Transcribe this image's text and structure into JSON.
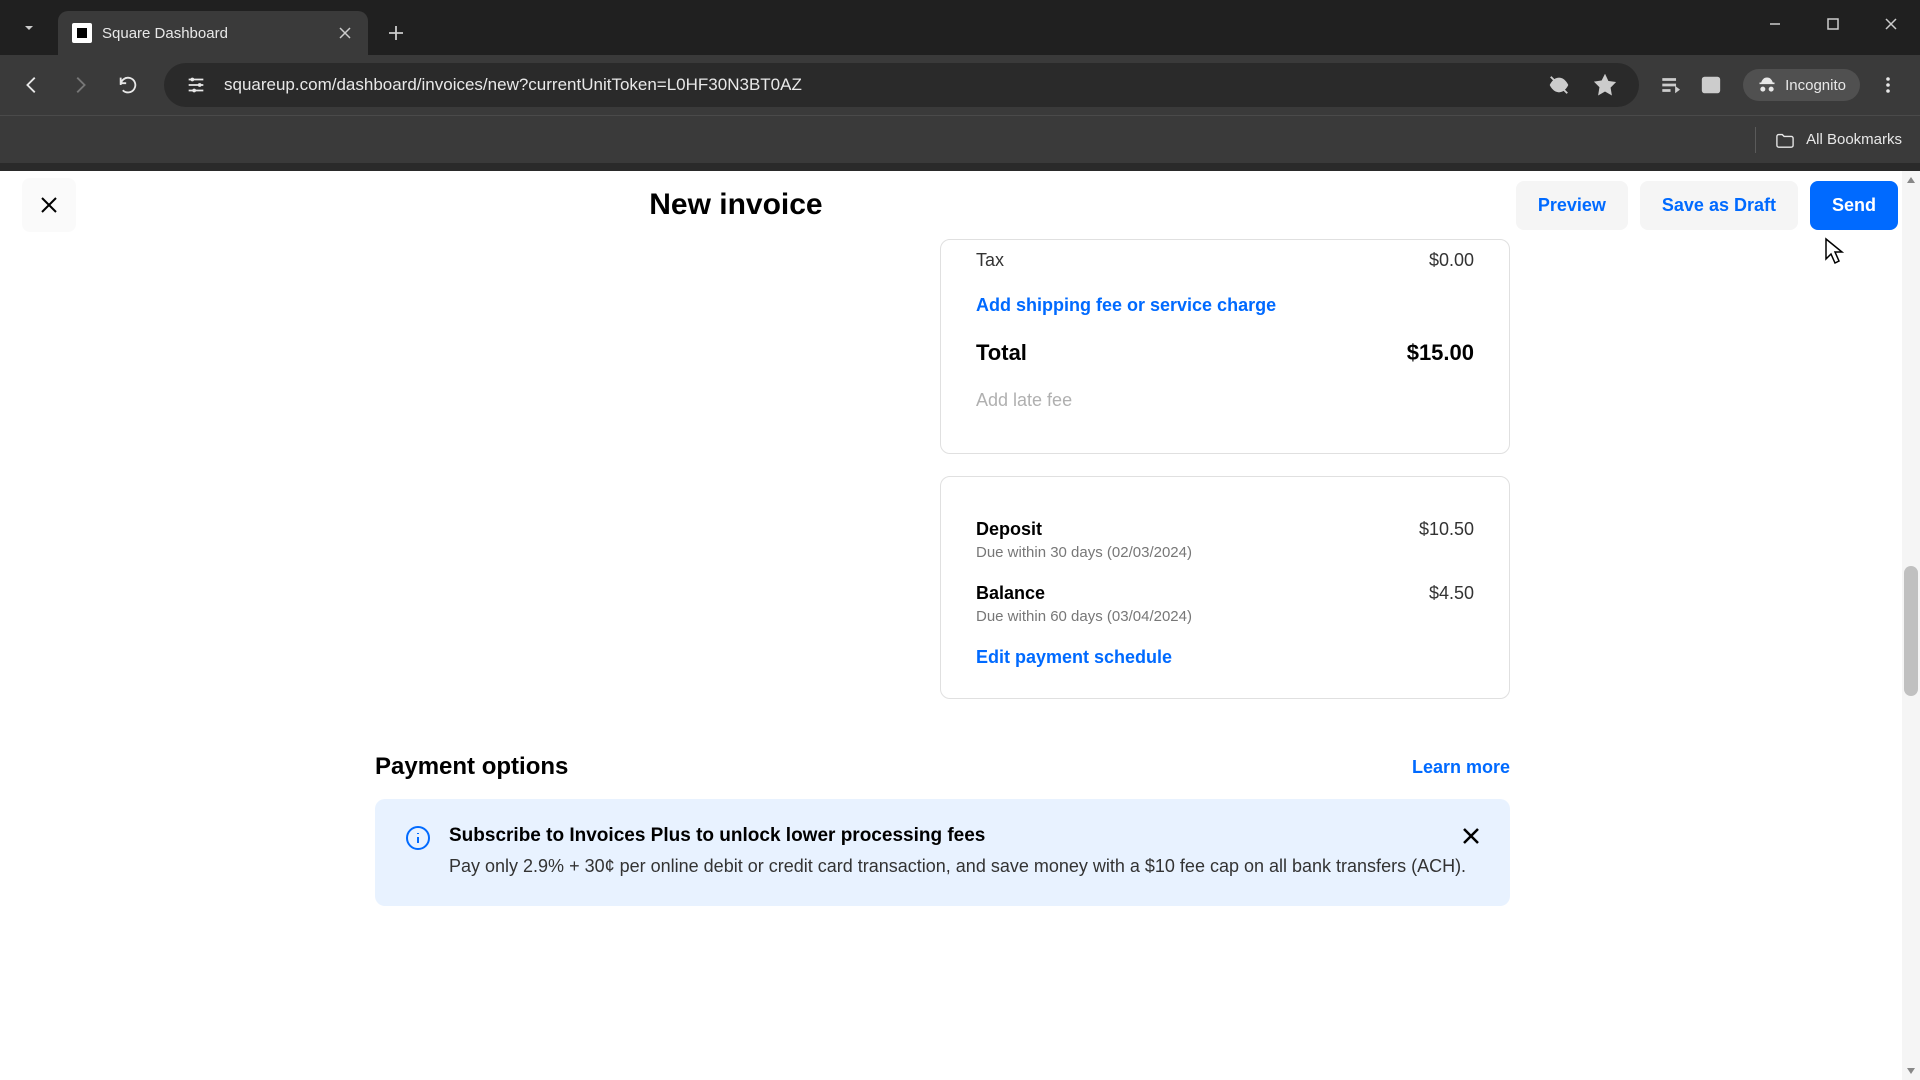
{
  "browser": {
    "tab_title": "Square Dashboard",
    "url": "squareup.com/dashboard/invoices/new?currentUnitToken=L0HF30N3BT0AZ",
    "incognito_label": "Incognito",
    "all_bookmarks_label": "All Bookmarks"
  },
  "header": {
    "title": "New invoice",
    "preview_label": "Preview",
    "save_draft_label": "Save as Draft",
    "send_label": "Send"
  },
  "summary": {
    "tax_label": "Tax",
    "tax_value": "$0.00",
    "add_shipping_label": "Add shipping fee or service charge",
    "total_label": "Total",
    "total_value": "$15.00",
    "add_late_fee_label": "Add late fee"
  },
  "schedule": {
    "deposit_label": "Deposit",
    "deposit_amount": "$10.50",
    "deposit_due": "Due within 30 days (02/03/2024)",
    "balance_label": "Balance",
    "balance_amount": "$4.50",
    "balance_due": "Due within 60 days (03/04/2024)",
    "edit_label": "Edit payment schedule"
  },
  "payment_options": {
    "title": "Payment options",
    "learn_more_label": "Learn more"
  },
  "promo": {
    "title": "Subscribe to Invoices Plus to unlock lower processing fees",
    "text": "Pay only 2.9% + 30¢ per online debit or credit card transaction, and save money with a $10 fee cap on all bank transfers (ACH)."
  }
}
